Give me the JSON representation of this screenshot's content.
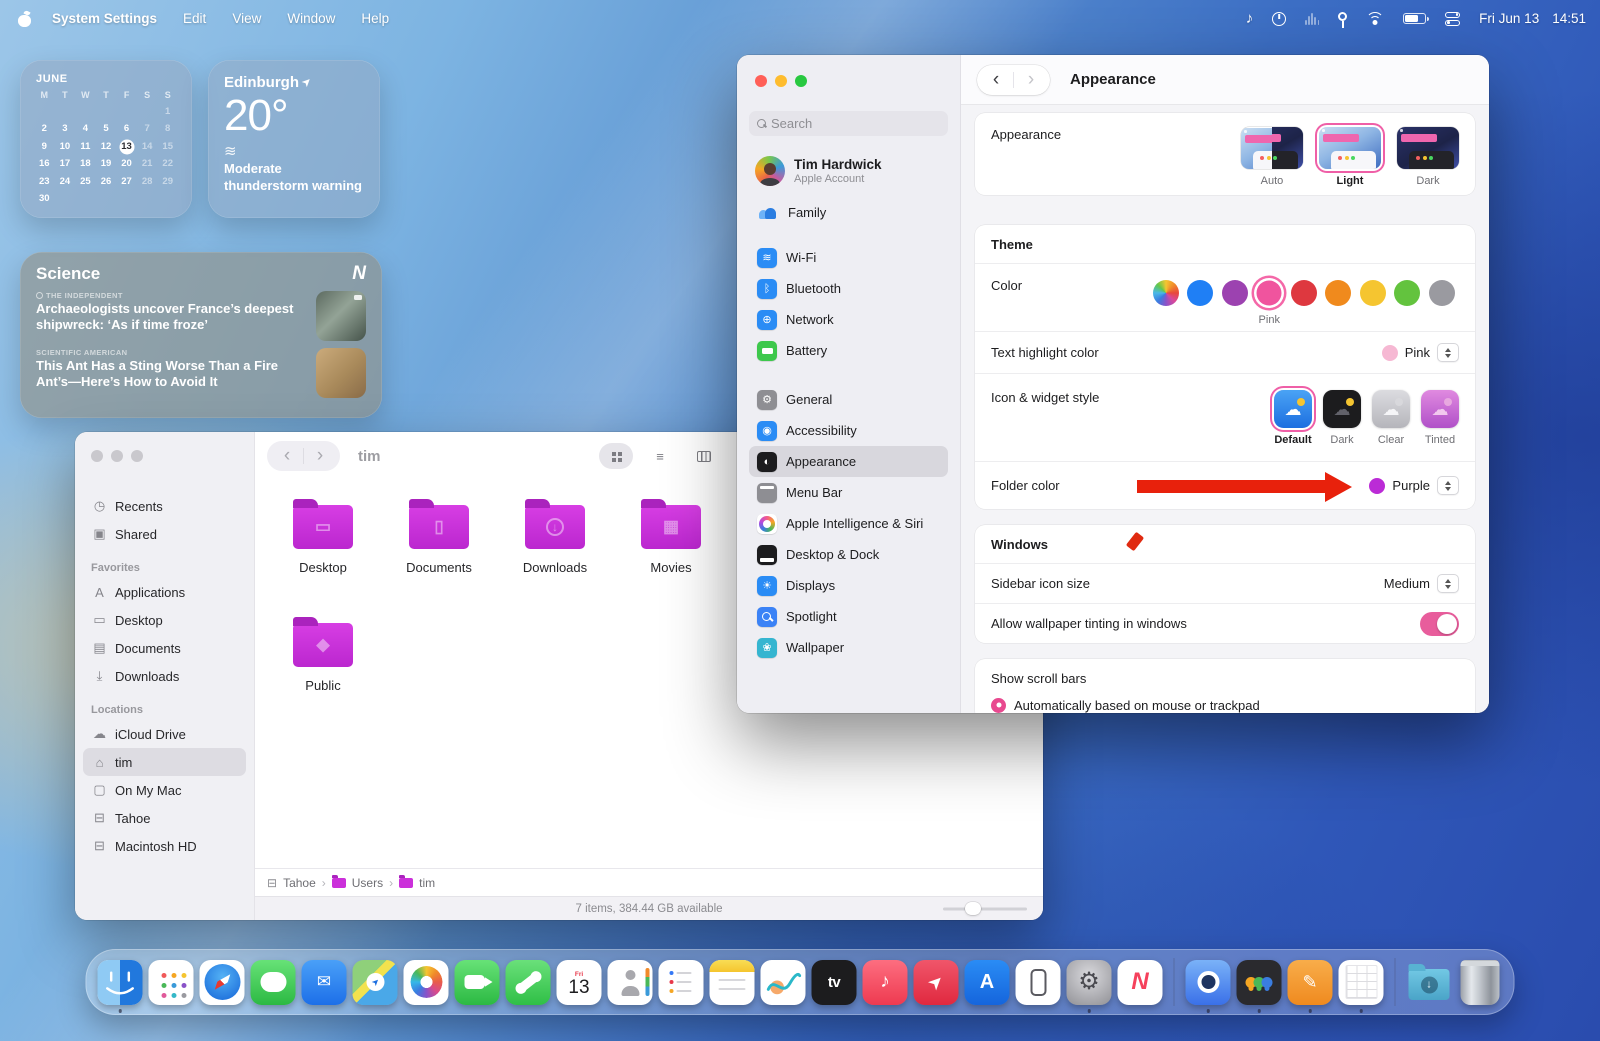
{
  "menu_bar": {
    "app_name": "System Settings",
    "menus": [
      "Edit",
      "View",
      "Window",
      "Help"
    ],
    "date": "Fri Jun 13",
    "time": "14:51"
  },
  "widgets": {
    "calendar": {
      "month": "JUNE",
      "day_headers": [
        "M",
        "T",
        "W",
        "T",
        "F",
        "S",
        "S"
      ],
      "weeks": [
        [
          "",
          "",
          "",
          "",
          "",
          "",
          "1"
        ],
        [
          "2",
          "3",
          "4",
          "5",
          "6",
          "7",
          "8"
        ],
        [
          "9",
          "10",
          "11",
          "12",
          "13",
          "14",
          "15"
        ],
        [
          "16",
          "17",
          "18",
          "19",
          "20",
          "21",
          "22"
        ],
        [
          "23",
          "24",
          "25",
          "26",
          "27",
          "28",
          "29"
        ],
        [
          "30",
          "",
          "",
          "",
          "",
          "",
          ""
        ]
      ],
      "today": "13"
    },
    "weather": {
      "city": "Edinburgh",
      "temperature": "20°",
      "condition": "Moderate thunderstorm warning"
    },
    "news": {
      "title": "Science",
      "stories": [
        {
          "source": "THE INDEPENDENT",
          "headline": "Archaeologists uncover France’s deepest shipwreck: ‘As if time froze’"
        },
        {
          "source": "SCIENTIFIC AMERICAN",
          "headline": "This Ant Has a Sting Worse Than a Fire Ant’s—Here’s How to Avoid It"
        }
      ]
    }
  },
  "finder": {
    "window_title": "tim",
    "sidebar": {
      "sections": [
        {
          "header": "",
          "items": [
            {
              "label": "Recents",
              "icon": "clock-icon"
            },
            {
              "label": "Shared",
              "icon": "shared-folder-icon"
            }
          ]
        },
        {
          "header": "Favorites",
          "items": [
            {
              "label": "Applications",
              "icon": "applications-icon"
            },
            {
              "label": "Desktop",
              "icon": "desktop-icon"
            },
            {
              "label": "Documents",
              "icon": "document-icon"
            },
            {
              "label": "Downloads",
              "icon": "download-icon"
            }
          ]
        },
        {
          "header": "Locations",
          "items": [
            {
              "label": "iCloud Drive",
              "icon": "cloud-icon"
            },
            {
              "label": "tim",
              "icon": "home-icon",
              "selected": true
            },
            {
              "label": "On My Mac",
              "icon": "folder-icon"
            },
            {
              "label": "Tahoe",
              "icon": "disk-icon"
            },
            {
              "label": "Macintosh HD",
              "icon": "disk-icon"
            }
          ]
        }
      ]
    },
    "folders": [
      {
        "name": "Desktop",
        "glyph": "desktop"
      },
      {
        "name": "Documents",
        "glyph": "document"
      },
      {
        "name": "Downloads",
        "glyph": "download"
      },
      {
        "name": "Movies",
        "glyph": "movies"
      },
      {
        "name": "Public",
        "glyph": "public"
      }
    ],
    "folder_color": "#cb30da",
    "path": [
      {
        "label": "Tahoe",
        "icon": "disk-icon"
      },
      {
        "label": "Users",
        "icon": "folder-icon"
      },
      {
        "label": "tim",
        "icon": "folder-icon"
      }
    ],
    "status_text": "7 items, 384.44 GB available"
  },
  "settings": {
    "search_placeholder": "Search",
    "account": {
      "name": "Tim Hardwick",
      "subtitle": "Apple Account"
    },
    "family_label": "Family",
    "nav": [
      {
        "items": [
          {
            "label": "Wi-Fi",
            "icon": "wifi-icon"
          },
          {
            "label": "Bluetooth",
            "icon": "bluetooth-icon"
          },
          {
            "label": "Network",
            "icon": "globe-icon"
          },
          {
            "label": "Battery",
            "icon": "battery-icon"
          }
        ]
      },
      {
        "items": [
          {
            "label": "General",
            "icon": "gear-icon"
          },
          {
            "label": "Accessibility",
            "icon": "accessibility-icon"
          },
          {
            "label": "Appearance",
            "icon": "appearance-icon",
            "selected": true
          },
          {
            "label": "Menu Bar",
            "icon": "menu-bar-icon"
          },
          {
            "label": "Apple Intelligence & Siri",
            "icon": "siri-icon"
          },
          {
            "label": "Desktop & Dock",
            "icon": "desktop-dock-icon"
          },
          {
            "label": "Displays",
            "icon": "displays-icon"
          },
          {
            "label": "Spotlight",
            "icon": "spotlight-icon"
          },
          {
            "label": "Wallpaper",
            "icon": "wallpaper-icon"
          }
        ]
      }
    ],
    "pane": {
      "title": "Appearance",
      "appearance_row_label": "Appearance",
      "modes": [
        {
          "label": "Auto"
        },
        {
          "label": "Light",
          "selected": true
        },
        {
          "label": "Dark"
        }
      ],
      "theme_heading": "Theme",
      "color_label": "Color",
      "theme_colors": [
        {
          "name": "Multicolor",
          "hex": "rainbow"
        },
        {
          "name": "Blue",
          "hex": "#1f7ff5"
        },
        {
          "name": "Purple",
          "hex": "#9c42b0"
        },
        {
          "name": "Pink",
          "hex": "#f0549e",
          "selected": true
        },
        {
          "name": "Red",
          "hex": "#de383f"
        },
        {
          "name": "Orange",
          "hex": "#f08a1d"
        },
        {
          "name": "Yellow",
          "hex": "#f5c530"
        },
        {
          "name": "Green",
          "hex": "#63c33e"
        },
        {
          "name": "Gray",
          "hex": "#9a9aa0"
        }
      ],
      "selected_color_label": "Pink",
      "text_highlight": {
        "label": "Text highlight color",
        "value": "Pink",
        "swatch": "#f6b8d3"
      },
      "icon_style": {
        "label": "Icon & widget style",
        "options": [
          "Default",
          "Dark",
          "Clear",
          "Tinted"
        ],
        "selected": "Default"
      },
      "folder_color": {
        "label": "Folder color",
        "value": "Purple",
        "swatch": "#bb2bd6"
      },
      "windows_heading": "Windows",
      "sidebar_icon_size": {
        "label": "Sidebar icon size",
        "value": "Medium"
      },
      "wallpaper_tinting": {
        "label": "Allow wallpaper tinting in windows",
        "on": true
      },
      "scroll_bars": {
        "label": "Show scroll bars",
        "options": [
          {
            "label": "Automatically based on mouse or trackpad",
            "selected": true
          }
        ]
      }
    }
  },
  "dock": {
    "apps": [
      {
        "name": "finder",
        "label": "Finder",
        "running": true
      },
      {
        "name": "launchpad",
        "label": "Apps"
      },
      {
        "name": "safari",
        "label": "Safari"
      },
      {
        "name": "messages",
        "label": "Messages"
      },
      {
        "name": "mail",
        "label": "Mail"
      },
      {
        "name": "maps",
        "label": "Maps"
      },
      {
        "name": "photos",
        "label": "Photos"
      },
      {
        "name": "facetime",
        "label": "FaceTime"
      },
      {
        "name": "phone",
        "label": "Phone"
      },
      {
        "name": "calendar",
        "label": "Calendar",
        "badge_weekday": "Fri",
        "badge_day": "13"
      },
      {
        "name": "contacts",
        "label": "Contacts"
      },
      {
        "name": "reminders",
        "label": "Reminders"
      },
      {
        "name": "notes",
        "label": "Notes"
      },
      {
        "name": "freeform",
        "label": "Freeform"
      },
      {
        "name": "tv",
        "label": "TV",
        "text": "tv"
      },
      {
        "name": "music",
        "label": "Music"
      },
      {
        "name": "rocket",
        "label": "Rocket"
      },
      {
        "name": "appstore",
        "label": "App Store",
        "text": "A"
      },
      {
        "name": "iphone-mirroring",
        "label": "iPhone Mirroring"
      },
      {
        "name": "settings",
        "label": "System Settings",
        "running": true
      },
      {
        "name": "news",
        "label": "News",
        "text": "N"
      },
      {
        "name": "divider"
      },
      {
        "name": "speaker",
        "label": "Speaker",
        "running": true
      },
      {
        "name": "passwords",
        "label": "Passwords",
        "running": true
      },
      {
        "name": "pages",
        "label": "Pages",
        "running": true
      },
      {
        "name": "grid-doc",
        "label": "Document",
        "running": true
      },
      {
        "name": "divider"
      },
      {
        "name": "downloads",
        "label": "Downloads"
      },
      {
        "name": "trash",
        "label": "Trash"
      }
    ]
  },
  "colors": {
    "accent_pink": "#f0549e",
    "folder_purple": "#cb30da",
    "annotation_red": "#e8210c"
  }
}
